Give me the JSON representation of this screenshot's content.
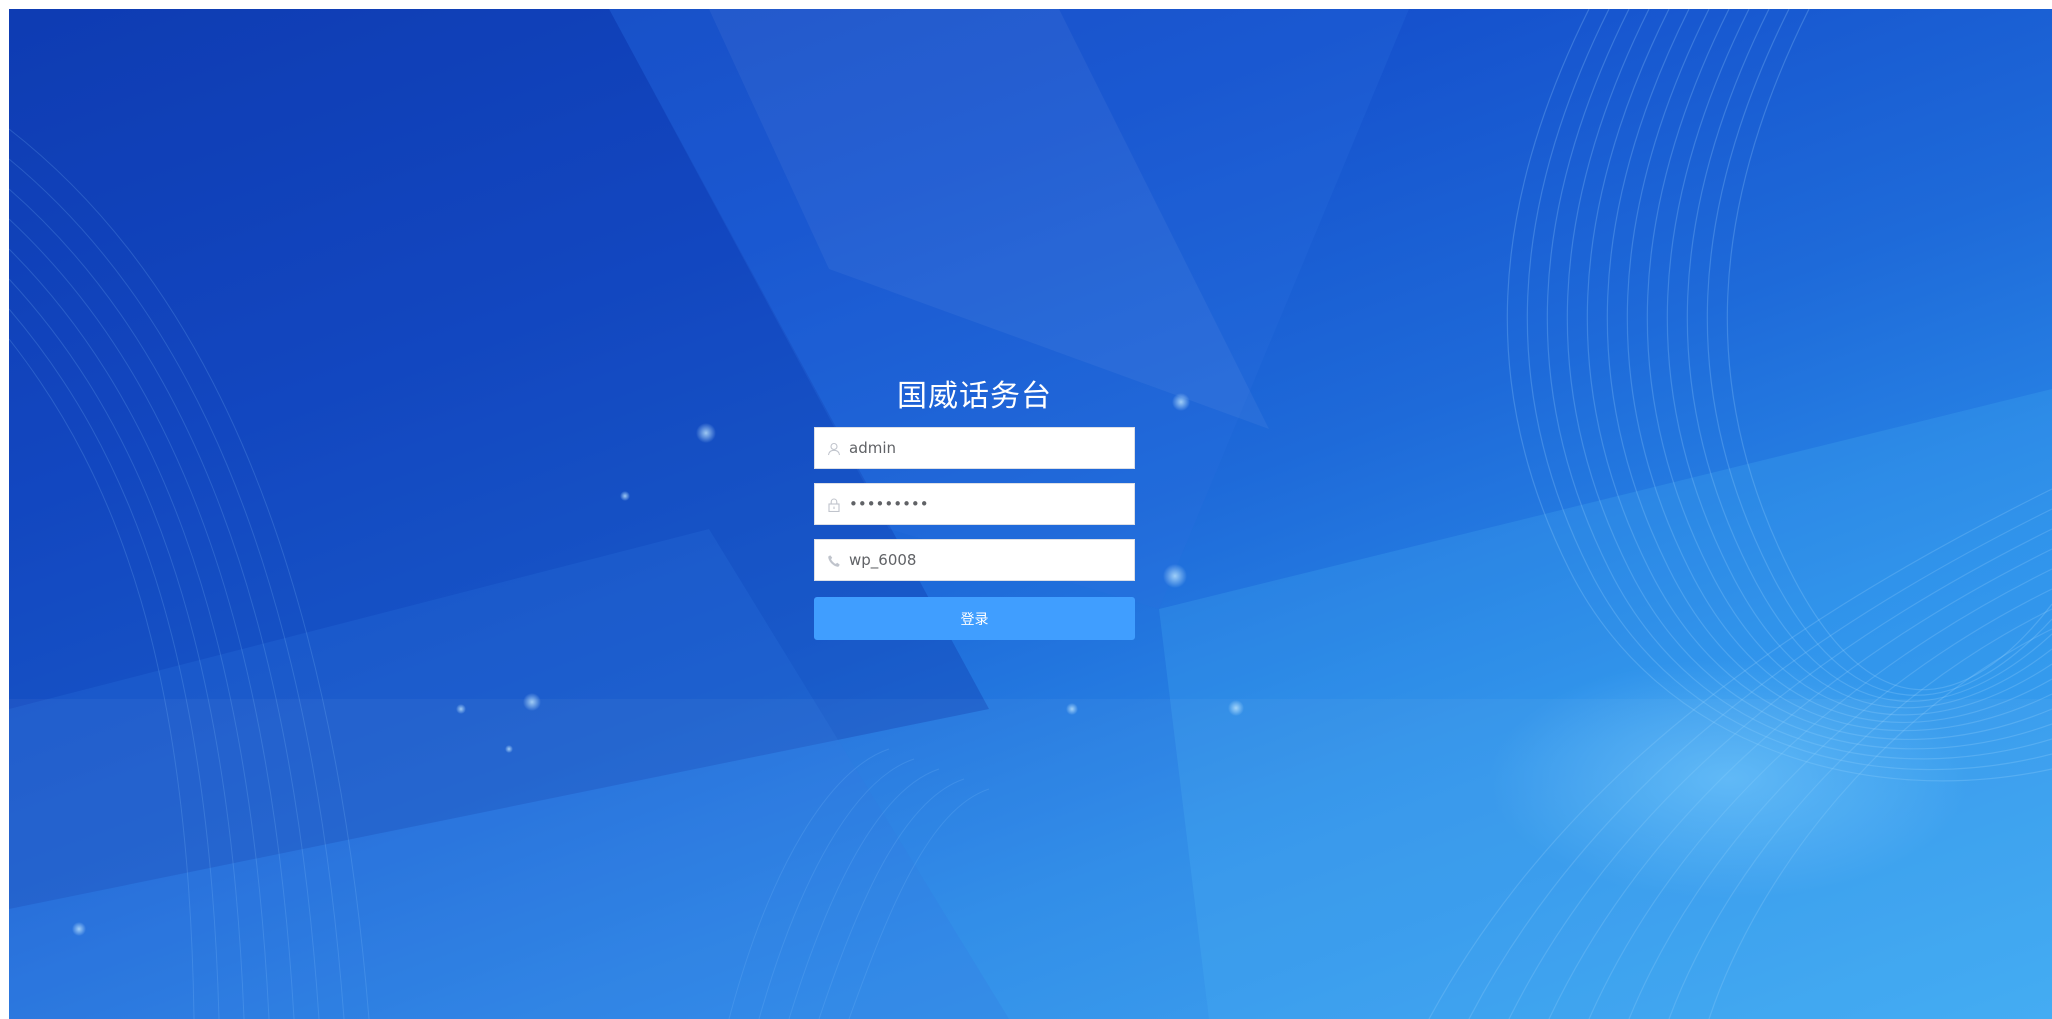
{
  "login": {
    "title": "国威话务台",
    "username": {
      "value": "admin",
      "icon": "user-icon"
    },
    "password": {
      "value": "admin1234",
      "icon": "lock-icon"
    },
    "extension": {
      "value": "wp_6008",
      "icon": "phone-icon"
    },
    "submit_label": "登录"
  },
  "colors": {
    "primary_button": "#409eff",
    "background_dark": "#0f3fb8",
    "background_light": "#3aa6f2",
    "icon_gray": "#c0c4cc"
  }
}
